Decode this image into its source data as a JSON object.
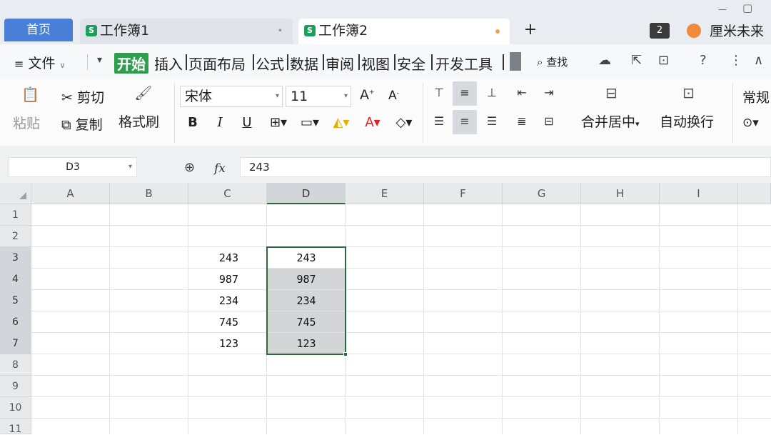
{
  "tabs": {
    "home": "首页",
    "workbooks": [
      {
        "name": "工作簿1",
        "icon": "S"
      },
      {
        "name": "工作簿2",
        "icon": "S"
      }
    ],
    "add": "+",
    "count_badge": "2",
    "user_name": "厘米未来"
  },
  "menu": {
    "file": "文件",
    "ribbon_tabs": [
      "开始",
      "插入",
      "页面布局",
      "公式",
      "数据",
      "审阅",
      "视图",
      "安全",
      "开发工具"
    ],
    "active_tab": "开始",
    "find": "查找"
  },
  "ribbon": {
    "paste": "粘贴",
    "cut": "剪切",
    "copy": "复制",
    "format_painter": "格式刷",
    "font_name": "宋体",
    "font_size": "11",
    "bold": "B",
    "italic": "I",
    "underline": "U",
    "font_grow": "A",
    "font_shrink": "A",
    "merge_center": "合并居中",
    "wrap_text": "自动换行",
    "number_format": "常规"
  },
  "formula_bar": {
    "cell_ref": "D3",
    "fx": "fx",
    "value": "243"
  },
  "sheet": {
    "columns": [
      "A",
      "B",
      "C",
      "D",
      "E",
      "F",
      "G",
      "H",
      "I"
    ],
    "rows": [
      "1",
      "2",
      "3",
      "4",
      "5",
      "6",
      "7",
      "8",
      "9",
      "10",
      "11"
    ],
    "selected_column": "D",
    "selected_rows": [
      "3",
      "4",
      "5",
      "6",
      "7"
    ],
    "column_c": [
      "243",
      "987",
      "234",
      "745",
      "123"
    ],
    "column_d": [
      "243",
      "987",
      "234",
      "745",
      "123"
    ]
  },
  "icons": {
    "cut": "scissors-icon",
    "copy": "copy-icon",
    "format_painter": "brush-icon",
    "find": "magnifier-icon",
    "zoom": "zoom-icon"
  },
  "colors": {
    "home_tab": "#4a7fd8",
    "active_ribbon_tab": "#2f9f4f",
    "selection_border": "#2a6a3c",
    "selection_fill": "#d4d5d7"
  }
}
